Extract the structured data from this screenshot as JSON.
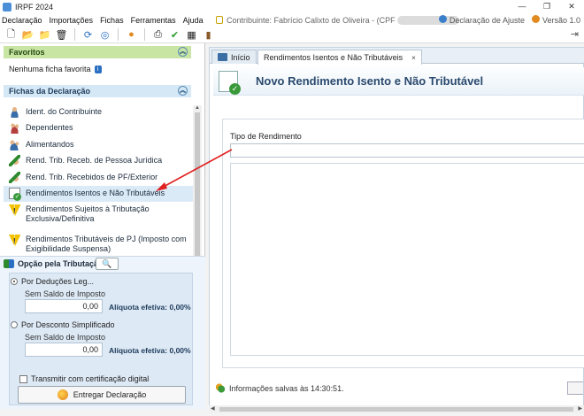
{
  "window": {
    "title": "IRPF 2024",
    "controls": [
      "—",
      "❐",
      "✕"
    ]
  },
  "menu": {
    "items": [
      "Declaração",
      "Importações",
      "Fichas",
      "Ferramentas",
      "Ajuda"
    ],
    "contributor": "Contribuinte: Fabrício Calixto de Oliveira - (CPF",
    "declaration_type": "Declaração de Ajuste",
    "version": "Versão 1.0"
  },
  "toolbar": {
    "icons": [
      "new-file-icon",
      "open-folder-icon",
      "folder-icon",
      "trash-icon",
      "import-icon",
      "web-icon",
      "globe-icon",
      "print-icon",
      "check-icon",
      "calculator-icon",
      "book-icon",
      "exit-icon"
    ]
  },
  "sidebar": {
    "favorites_title": "Favoritos",
    "favorites_empty": "Nenhuma ficha favorita",
    "fichas_title": "Fichas da Declaração",
    "fichas": [
      {
        "label": "Ident. do Contribuinte",
        "icon": "person-icon"
      },
      {
        "label": "Dependentes",
        "icon": "group-icon"
      },
      {
        "label": "Alimentandos",
        "icon": "children-icon"
      },
      {
        "label": "Rend. Trib. Receb. de Pessoa Jurídica",
        "icon": "money-in-icon"
      },
      {
        "label": "Rend. Trib. Recebidos de PF/Exterior",
        "icon": "money-in-icon"
      },
      {
        "label": "Rendimentos Isentos e Não Tributáveis",
        "icon": "document-check-icon"
      },
      {
        "label": "Rendimentos Sujeitos à Tributação Exclusiva/Definitiva",
        "icon": "warning-icon"
      },
      {
        "label": "Rendimentos Tributáveis de PJ (Imposto com Exigibilidade Suspensa)",
        "icon": "warning-icon"
      }
    ]
  },
  "opcao": {
    "title": "Opção pela Tributação:",
    "deducoes_label": "Por Deduções Leg...",
    "deducoes_sub": "Sem Saldo de Imposto",
    "deducoes_value": "0,00",
    "deducoes_aliquota": "Alíquota efetiva: 0,00%",
    "desconto_label": "Por Desconto Simplificado",
    "desconto_sub": "Sem Saldo de Imposto",
    "desconto_value": "0,00",
    "desconto_aliquota": "Alíquota efetiva: 0,00%",
    "certificado_label": "Transmitir com certificação digital",
    "entregar_label": "Entregar Declaração"
  },
  "tabs": [
    {
      "label": "Início"
    },
    {
      "label": "Rendimentos Isentos e Não Tributáveis",
      "close": "×"
    }
  ],
  "main": {
    "banner_title": "Novo Rendimento Isento e Não Tributável",
    "field_label": "Tipo de Rendimento",
    "field_value": "",
    "status": "Informações salvas às 14:30:51."
  },
  "colors": {
    "annotation_arrow": "#e02020",
    "favorites_header": "#c9e5a4",
    "fichas_header": "#d5e8f5",
    "banner_title": "#2b4a6e"
  }
}
